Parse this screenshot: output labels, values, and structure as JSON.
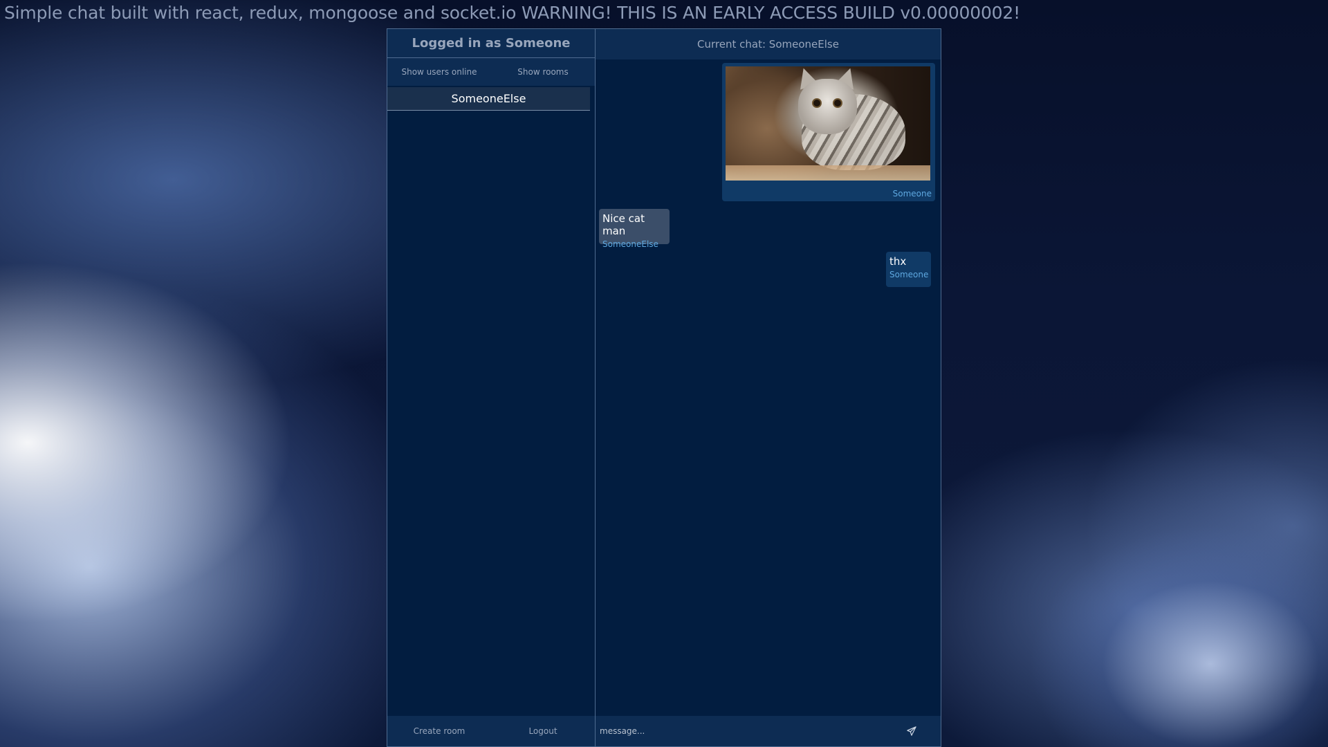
{
  "banner": {
    "text": "Simple chat built with react, redux, mongoose and socket.io WARNING! THIS IS AN EARLY ACCESS BUILD v0.00000002!"
  },
  "sidebar": {
    "header": "Logged in as Someone",
    "tabs": [
      {
        "label": "Show users online"
      },
      {
        "label": "Show rooms"
      }
    ],
    "users": [
      {
        "name": "SomeoneElse",
        "selected": true
      }
    ],
    "footer": {
      "create_room": "Create room",
      "logout": "Logout"
    }
  },
  "chat": {
    "header": "Current chat: SomeoneElse",
    "messages": [
      {
        "type": "image",
        "image": "cat-photo",
        "author": "Someone",
        "mine": true
      },
      {
        "type": "text",
        "text": "Nice cat man",
        "author": "SomeoneElse",
        "mine": false
      },
      {
        "type": "text",
        "text": "thx",
        "author": "Someone",
        "mine": true
      }
    ],
    "input": {
      "value": "",
      "placeholder": "message..."
    },
    "send_icon": "paper-plane-icon"
  },
  "colors": {
    "panel": "#021d40",
    "panel_header": "#0d2c53",
    "border": "#4f6b90",
    "mine_bubble": "#103a66",
    "other_bubble": "#3b4e69",
    "author": "#5ea8e0",
    "muted_text": "#98a6bc"
  }
}
